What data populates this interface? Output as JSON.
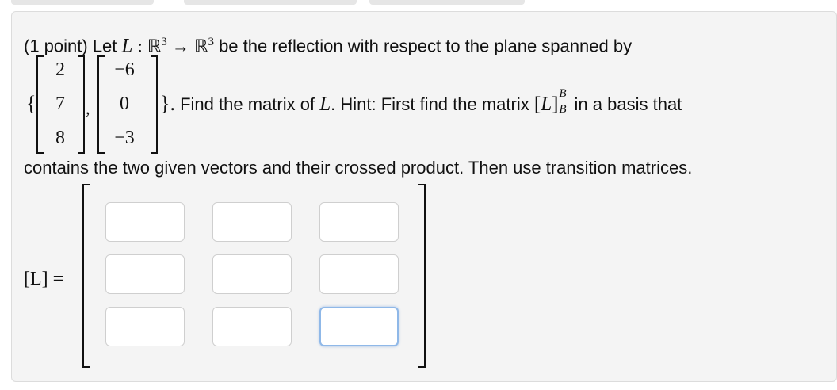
{
  "problem": {
    "intro_prefix": "(1 point) Let",
    "map_symbol": "L",
    "colon": ":",
    "domain": "ℝ",
    "exp": "3",
    "arrow": "→",
    "codomain": "ℝ",
    "exp2": "3",
    "intro_suffix": "be the reflection with respect to the plane spanned by",
    "vector1": [
      "2",
      "7",
      "8"
    ],
    "vector2": [
      "−6",
      "0",
      "−3"
    ],
    "brace_open": "{",
    "comma": ",",
    "brace_close": "}.",
    "line2_text": "Find the matrix of",
    "line2_L": "L",
    "line2_dot": ".",
    "hint_text": "Hint: First find the matrix",
    "hint_matrix_open": "[",
    "hint_matrix_L": "L",
    "hint_matrix_close": "]",
    "hint_sup": "B",
    "hint_sub": "B",
    "hint_suffix": "in a basis that",
    "line3": "contains the two given vectors and their crossed product. Then use transition matrices."
  },
  "answer": {
    "label": "[L] =",
    "matrix_values": [
      [
        "",
        "",
        ""
      ],
      [
        "",
        "",
        ""
      ],
      [
        "",
        "",
        ""
      ]
    ]
  }
}
